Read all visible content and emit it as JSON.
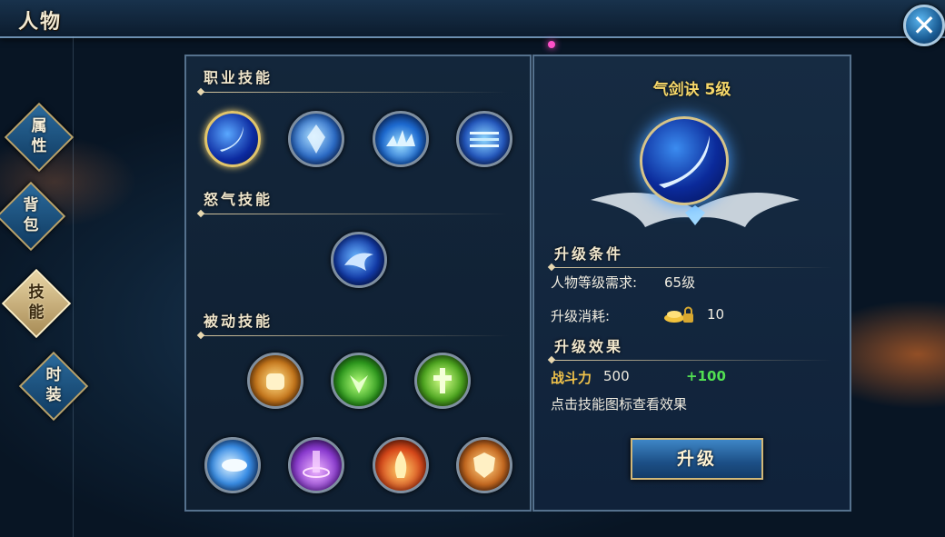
{
  "header": {
    "title": "人物",
    "close_icon": "close-icon"
  },
  "nav": {
    "tabs": [
      {
        "label": "属\n性",
        "active": false
      },
      {
        "label": "背\n包",
        "active": false
      },
      {
        "label": "技\n能",
        "active": true
      },
      {
        "label": "时\n装",
        "active": false
      }
    ]
  },
  "skills": {
    "profession_title": "职业技能",
    "rage_title": "怒气技能",
    "passive_title": "被动技能"
  },
  "detail": {
    "skill_name": "气剑诀  5级",
    "upgrade_conditions_title": "升级条件",
    "level_req_label": "人物等级需求:",
    "level_req_value": "65级",
    "cost_label": "升级消耗:",
    "cost_value": "10",
    "upgrade_effect_title": "升级效果",
    "power_label": "战斗力",
    "power_value": "500",
    "power_gain": "+100",
    "hint": "点击技能图标查看效果",
    "upgrade_button": "升级"
  },
  "colors": {
    "accent_gold": "#f6d86a",
    "gain_green": "#52e052",
    "panel_border": "#55718d"
  }
}
